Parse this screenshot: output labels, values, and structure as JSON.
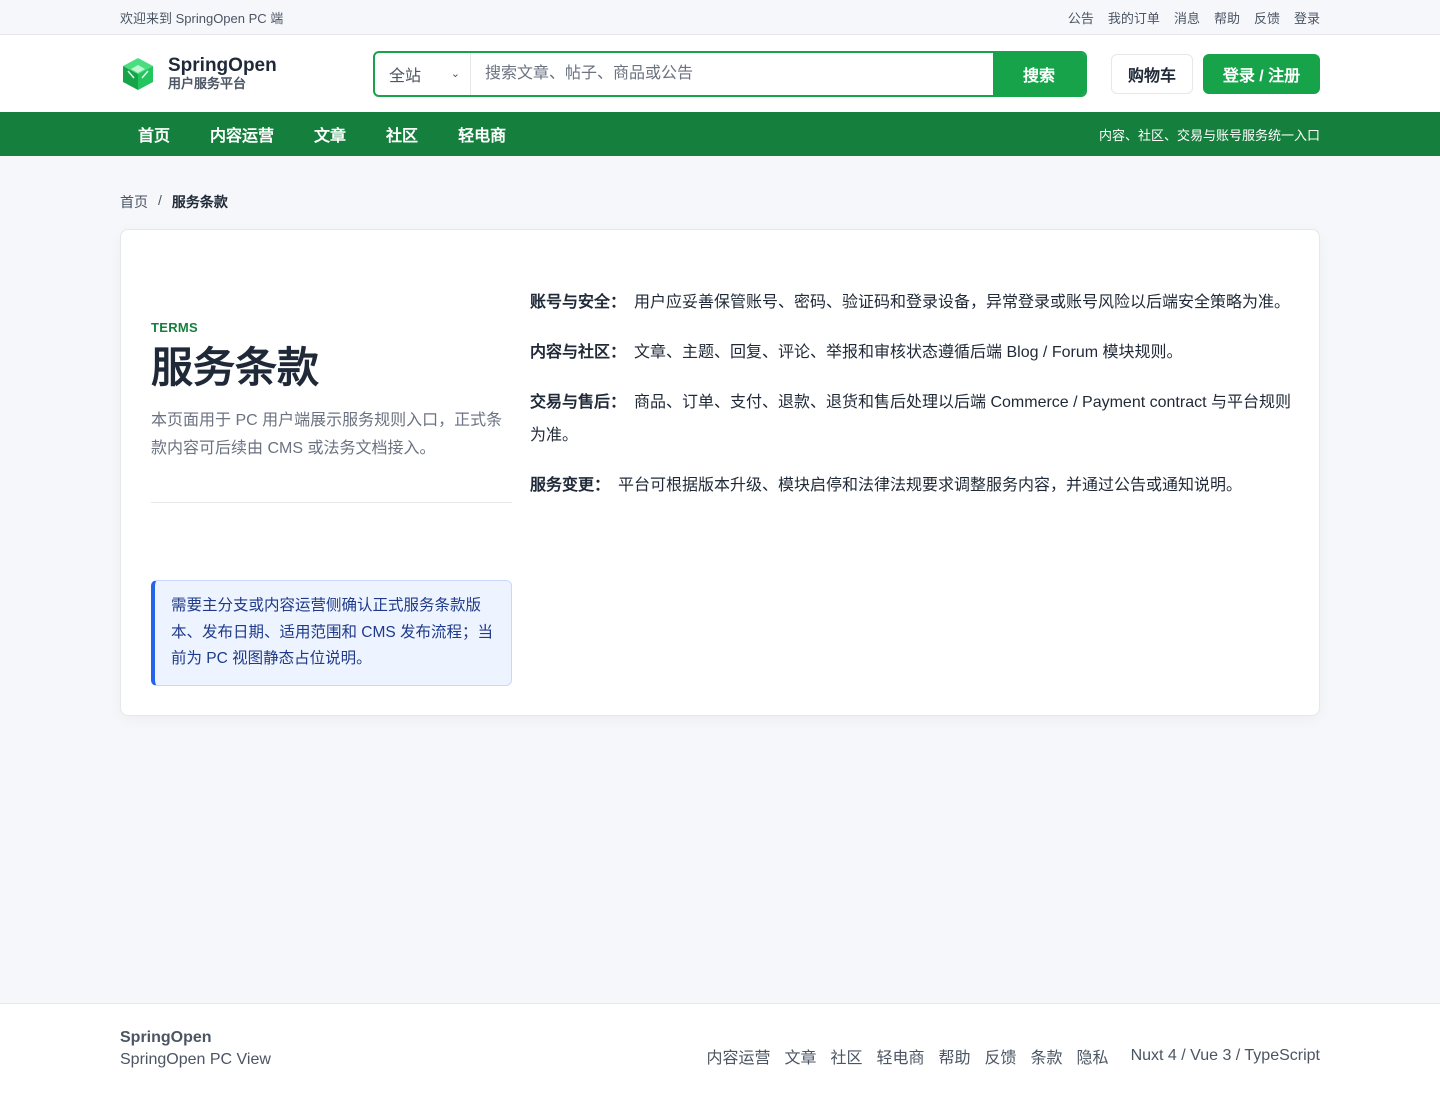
{
  "topbar": {
    "welcome": "欢迎来到 SpringOpen PC 端",
    "links": [
      "公告",
      "我的订单",
      "消息",
      "帮助",
      "反馈",
      "登录"
    ]
  },
  "header": {
    "brand_name": "SpringOpen",
    "brand_sub": "用户服务平台",
    "search_scope": "全站",
    "search_placeholder": "搜索文章、帖子、商品或公告",
    "search_button": "搜索",
    "cart": "购物车",
    "login": "登录 / 注册"
  },
  "nav": {
    "items": [
      "首页",
      "内容运营",
      "文章",
      "社区",
      "轻电商"
    ],
    "slogan": "内容、社区、交易与账号服务统一入口"
  },
  "breadcrumb": {
    "home": "首页",
    "separator": "/",
    "current": "服务条款"
  },
  "page": {
    "eyebrow": "TERMS",
    "title": "服务条款",
    "description": "本页面用于 PC 用户端展示服务规则入口，正式条款内容可后续由 CMS 或法务文档接入。",
    "notice": "需要主分支或内容运营侧确认正式服务条款版本、发布日期、适用范围和 CMS 发布流程；当前为 PC 视图静态占位说明。",
    "terms": [
      {
        "label": "账号与安全：",
        "text": "用户应妥善保管账号、密码、验证码和登录设备，异常登录或账号风险以后端安全策略为准。"
      },
      {
        "label": "内容与社区：",
        "text": "文章、主题、回复、评论、举报和审核状态遵循后端 Blog / Forum 模块规则。"
      },
      {
        "label": "交易与售后：",
        "text": "商品、订单、支付、退款、退货和售后处理以后端 Commerce / Payment contract 与平台规则为准。"
      },
      {
        "label": "服务变更：",
        "text": "平台可根据版本升级、模块启停和法律法规要求调整服务内容，并通过公告或通知说明。"
      }
    ]
  },
  "footer": {
    "brand": "SpringOpen",
    "sub": "SpringOpen PC View",
    "links": [
      "内容运营",
      "文章",
      "社区",
      "轻电商",
      "帮助",
      "反馈",
      "条款",
      "隐私"
    ],
    "stack": "Nuxt 4 / Vue 3 / TypeScript"
  },
  "colors": {
    "brand_green": "#16a34a",
    "nav_green": "#15803d",
    "notice_blue": "#2563eb"
  },
  "icons": {
    "logo": "green-cube-logo-icon",
    "scope_dropdown": "chevron-down-icon"
  }
}
